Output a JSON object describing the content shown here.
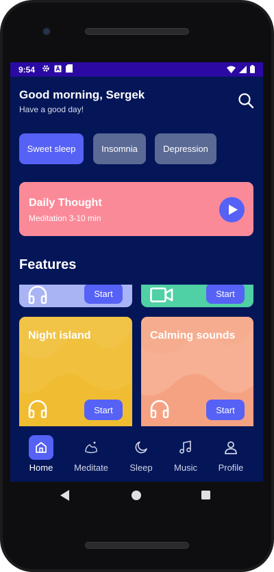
{
  "status_bar": {
    "time": "9:54"
  },
  "header": {
    "greeting": "Good morning,  Sergek",
    "subtitle": "Have a good day!"
  },
  "chips": [
    {
      "label": "Sweet sleep",
      "active": true
    },
    {
      "label": "Insomnia",
      "active": false
    },
    {
      "label": "Depression",
      "active": false
    }
  ],
  "daily_thought": {
    "title": "Daily Thought",
    "subtitle": "Meditation 3-10 min"
  },
  "features": {
    "title": "Features",
    "cards": [
      {
        "title": "",
        "start_label": "Start",
        "color": "#a9b4f5",
        "icon": "headphones-icon"
      },
      {
        "title": "",
        "start_label": "Start",
        "color": "#4fd0a5",
        "icon": "video-camera-icon"
      },
      {
        "title": "Night island",
        "start_label": "Start",
        "color": "#f0bd32",
        "icon": "headphones-icon"
      },
      {
        "title": "Calming sounds",
        "start_label": "Start",
        "color": "#f5a283",
        "icon": "headphones-icon"
      }
    ]
  },
  "bottom_nav": {
    "items": [
      {
        "label": "Home",
        "icon": "home-icon",
        "active": true
      },
      {
        "label": "Meditate",
        "icon": "meditate-icon",
        "active": false
      },
      {
        "label": "Sleep",
        "icon": "moon-icon",
        "active": false
      },
      {
        "label": "Music",
        "icon": "music-note-icon",
        "active": false
      },
      {
        "label": "Profile",
        "icon": "person-icon",
        "active": false
      }
    ]
  },
  "colors": {
    "background": "#041658",
    "status_bar": "#2b0aa3",
    "accent": "#5661f5",
    "chip_inactive": "#5a6a94",
    "daily_card": "#fb8a99"
  }
}
